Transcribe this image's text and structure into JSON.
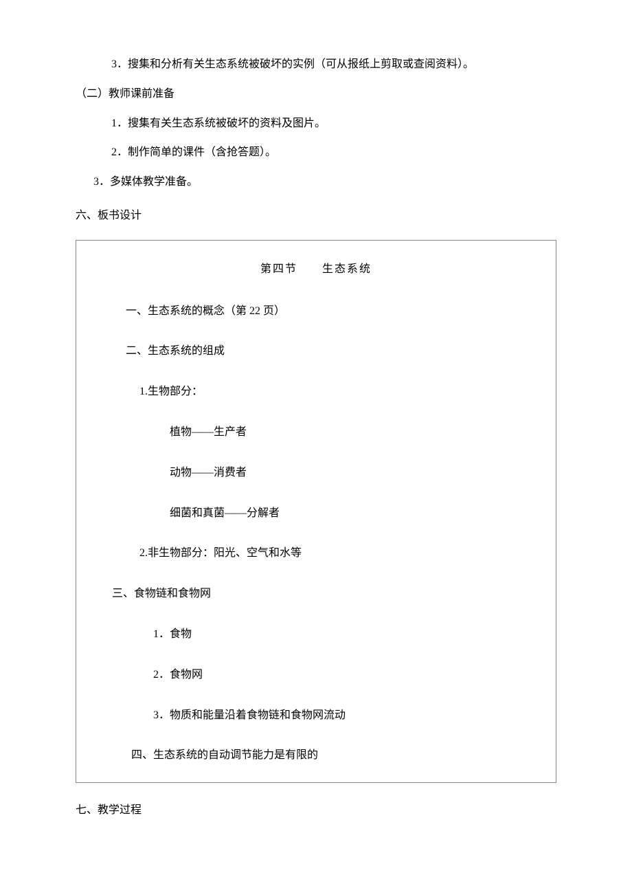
{
  "prep_items": {
    "item3": "3．搜集和分析有关生态系统被破坏的实例（可从报纸上剪取或查阅资料）。"
  },
  "teacher_prep_heading": "（二）教师课前准备",
  "teacher_prep": {
    "item1": "1．搜集有关生态系统被破坏的资料及图片。",
    "item2": "2．制作简单的课件（含抢答题）。",
    "item3": "3．多媒体教学准备。"
  },
  "section6_heading": "六、板书设计",
  "board": {
    "title": "第四节　　生态系统",
    "s1": "一、生态系统的概念（第 22 页）",
    "s2": "二、生态系统的组成",
    "s2_1": "1.生物部分：",
    "s2_1a": "植物——生产者",
    "s2_1b": "动物——消费者",
    "s2_1c": "细菌和真菌——分解者",
    "s2_2": "2.非生物部分：阳光、空气和水等",
    "s3": "三、食物链和食物网",
    "s3_1": "1．食物",
    "s3_2": "2．食物网",
    "s3_3": "3．物质和能量沿着食物链和食物网流动",
    "s4": "四、生态系统的自动调节能力是有限的"
  },
  "section7_heading": "七、教学过程"
}
